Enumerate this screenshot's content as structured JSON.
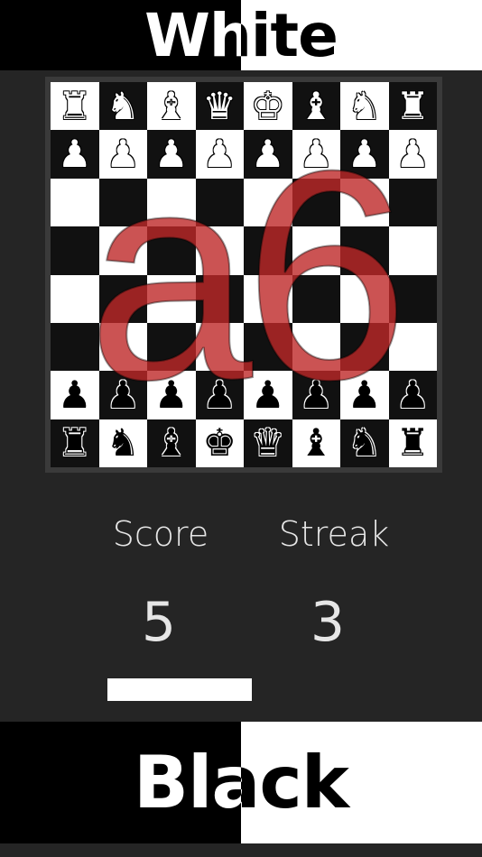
{
  "top_button": {
    "label": "White"
  },
  "bottom_button": {
    "label": "Black"
  },
  "board": {
    "overlay_square": "a6",
    "pieces": [
      [
        "♜",
        "♞",
        "♝",
        "♛",
        "♚",
        "♝",
        "♞",
        "♜"
      ],
      [
        "♟",
        "♟",
        "♟",
        "♟",
        "♟",
        "♟",
        "♟",
        "♟"
      ],
      [
        "",
        "",
        "",
        "",
        "",
        "",
        "",
        ""
      ],
      [
        "",
        "",
        "",
        "",
        "",
        "",
        "",
        ""
      ],
      [
        "",
        "",
        "",
        "",
        "",
        "",
        "",
        ""
      ],
      [
        "",
        "",
        "",
        "",
        "",
        "",
        "",
        ""
      ],
      [
        "♟",
        "♟",
        "♟",
        "♟",
        "♟",
        "♟",
        "♟",
        "♟"
      ],
      [
        "♜",
        "♞",
        "♝",
        "♚",
        "♛",
        "♝",
        "♞",
        "♜"
      ]
    ],
    "piece_colors": [
      "white",
      "white",
      "",
      "",
      "",
      "",
      "black",
      "black"
    ]
  },
  "stats": {
    "score_label": "Score",
    "score_value": "5",
    "streak_label": "Streak",
    "streak_value": "3"
  },
  "timer": {
    "remaining_fraction": 0.3
  },
  "colors": {
    "background": "#252525",
    "overlay": "#be2828"
  }
}
